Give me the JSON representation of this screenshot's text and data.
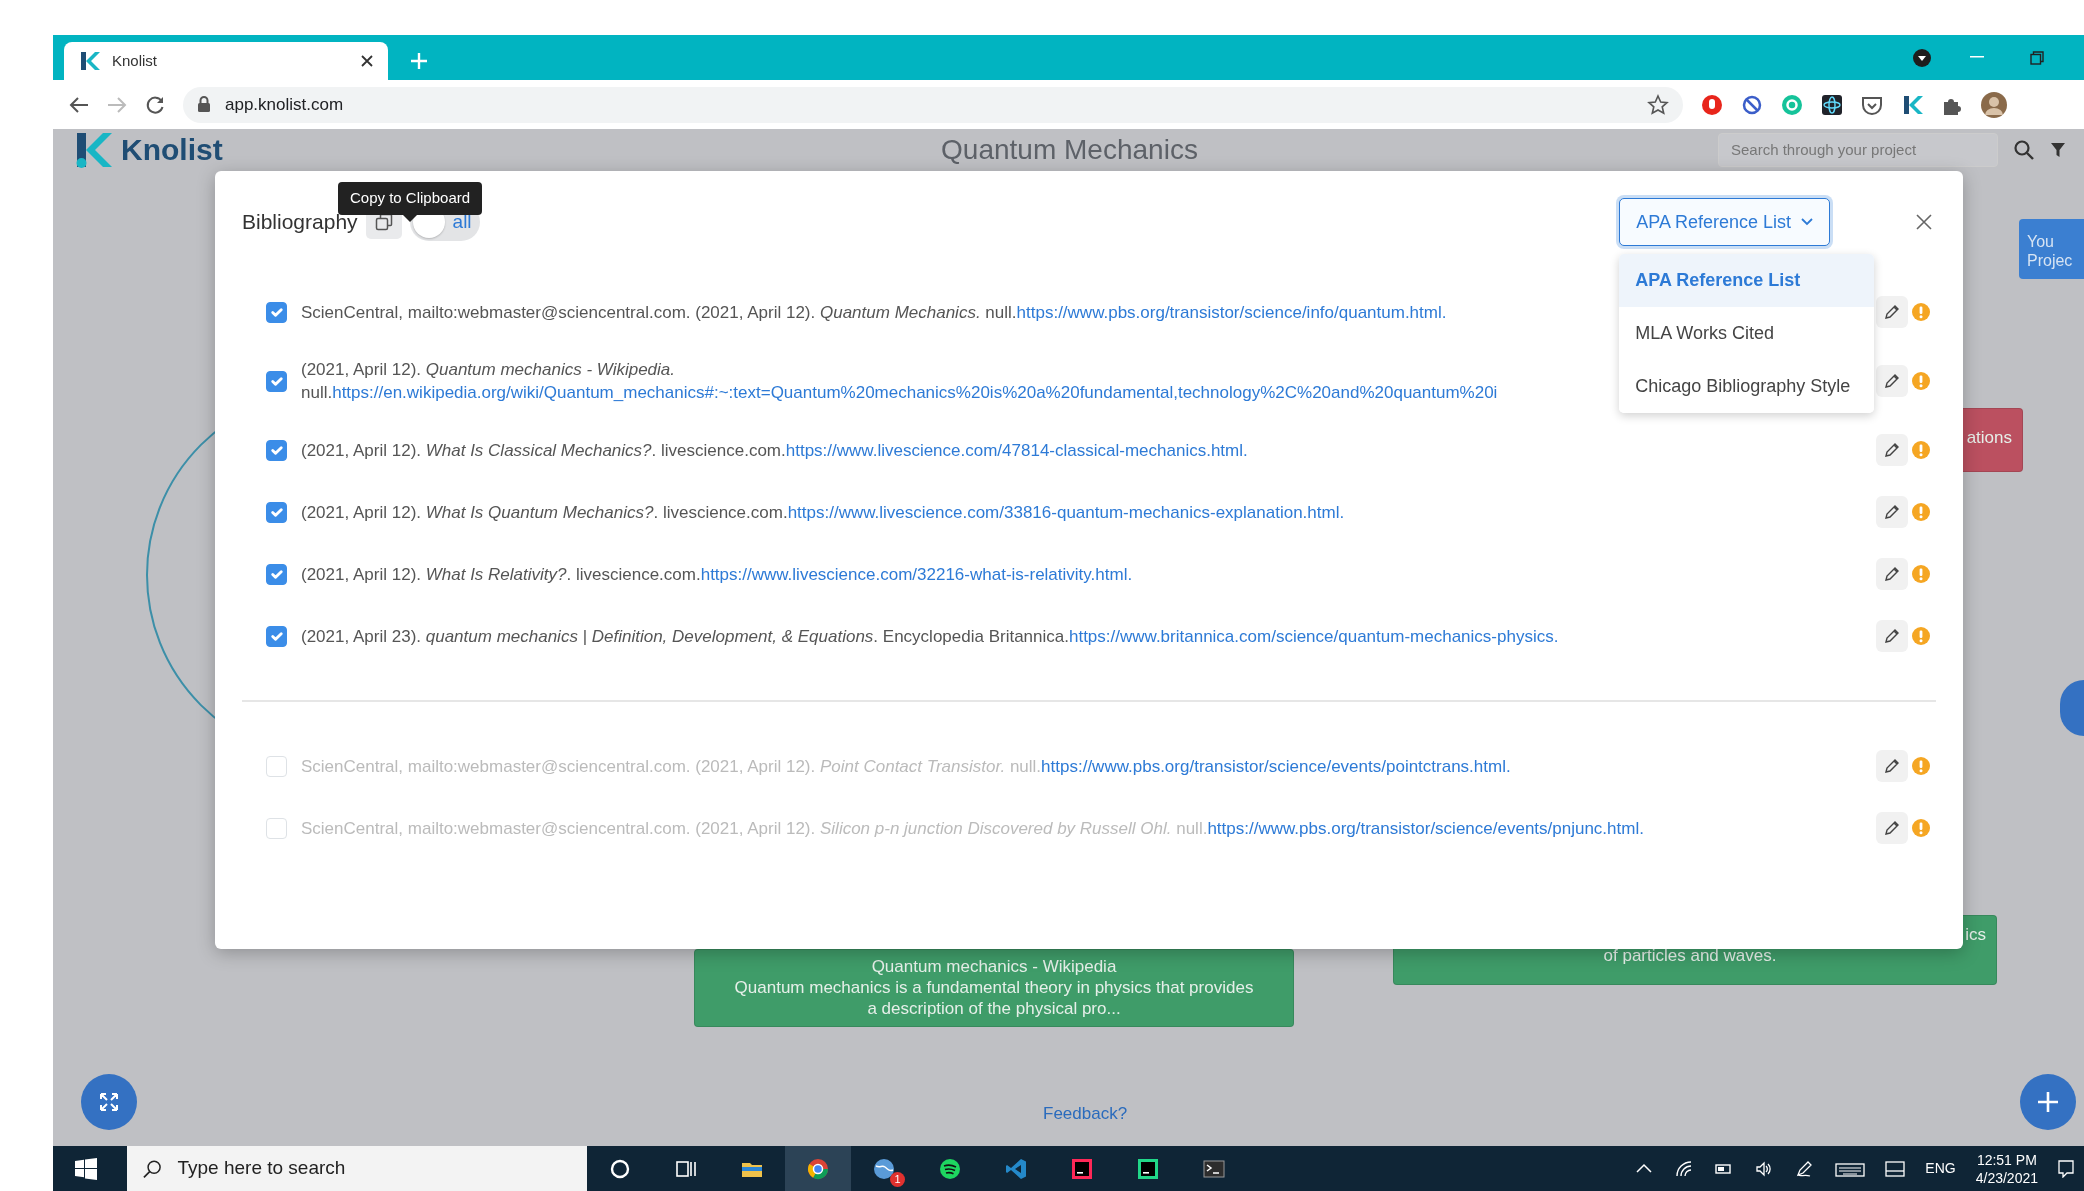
{
  "browser": {
    "tab_title": "Knolist",
    "url": "app.knolist.com"
  },
  "app": {
    "logo": "Knolist",
    "project_title": "Quantum Mechanics",
    "search": {
      "placeholder": "Search through your project"
    },
    "projects_button": [
      "You",
      "Projec"
    ],
    "feedback_link": "Feedback?"
  },
  "canvas_nodes": [
    {
      "color": "#bb5060",
      "lines": [
        "ations"
      ]
    },
    {
      "color": "#3f9c69",
      "lines": [
        "Quantum mechanics - Wikipedia",
        "Quantum mechanics is a fundamental theory in physics that provides",
        "a description of the physical pro..."
      ]
    },
    {
      "color": "#3f9c69",
      "lines": [
        "ics",
        "of particles and waves."
      ]
    }
  ],
  "tooltip": "Copy to Clipboard",
  "modal": {
    "title": "Bibliography",
    "toggle": {
      "label": "all",
      "on": false
    },
    "style_dropdown": {
      "label": "APA Reference List",
      "expanded": true,
      "options": [
        {
          "label": "APA Reference List",
          "selected": true
        },
        {
          "label": "MLA Works Cited",
          "selected": false
        },
        {
          "label": "Chicago Bibliography Style",
          "selected": false
        }
      ]
    },
    "included": [
      {
        "checked": true,
        "text": "ScienCentral, mailto:webmaster@sciencentral.com. (2021, April 12). *Quantum Mechanics.* null.",
        "link": "https://www.pbs.org/transistor/science/info/quantum.html."
      },
      {
        "checked": true,
        "text": "(2021, April 12). *Quantum mechanics - Wikipedia.* null.",
        "link": "https://en.wikipedia.org/wiki/Quantum_mechanics#:~:text=Quantum%20mechanics%20is%20a%20fundamental,technology%2C%20and%20quantum%20i"
      },
      {
        "checked": true,
        "text": "(2021, April 12). *What Is Classical Mechanics?*. livescience.com.",
        "link": "https://www.livescience.com/47814-classical-mechanics.html."
      },
      {
        "checked": true,
        "text": "(2021, April 12). *What Is Quantum Mechanics?*. livescience.com.",
        "link": "https://www.livescience.com/33816-quantum-mechanics-explanation.html."
      },
      {
        "checked": true,
        "text": "(2021, April 12). *What Is Relativity?*. livescience.com.",
        "link": "https://www.livescience.com/32216-what-is-relativity.html."
      },
      {
        "checked": true,
        "text": "(2021, April 23). *quantum mechanics | Definition, Development, & Equations*. Encyclopedia Britannica.",
        "link": "https://www.britannica.com/science/quantum-mechanics-physics."
      }
    ],
    "excluded": [
      {
        "checked": false,
        "text": "ScienCentral, mailto:webmaster@sciencentral.com. (2021, April 12). *Point Contact Transistor.* null.",
        "link": "https://www.pbs.org/transistor/science/events/pointctrans.html."
      },
      {
        "checked": false,
        "text": "ScienCentral, mailto:webmaster@sciencentral.com. (2021, April 12). *Silicon p-n junction Discovered by Russell Ohl.* null.",
        "link": "https://www.pbs.org/transistor/science/events/pnjunc.html."
      }
    ]
  },
  "taskbar": {
    "search_placeholder": "Type here to search",
    "badge": "1",
    "language": "ENG",
    "time": "12:51 PM",
    "date": "4/23/2021"
  }
}
